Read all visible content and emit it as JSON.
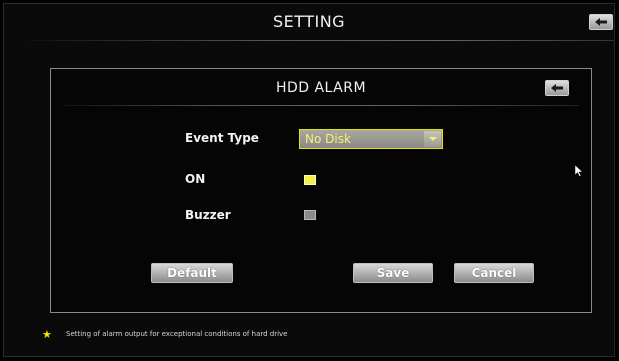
{
  "window": {
    "title": "SETTING",
    "back_icon": "left-arrow-icon"
  },
  "dialog": {
    "title": "HDD ALARM",
    "back_icon": "left-arrow-icon",
    "fields": {
      "event_type": {
        "label": "Event Type",
        "value": "No Disk"
      },
      "on": {
        "label": "ON",
        "checked": true
      },
      "buzzer": {
        "label": "Buzzer",
        "checked": false
      }
    },
    "buttons": {
      "default": "Default",
      "save": "Save",
      "cancel": "Cancel"
    }
  },
  "footer": {
    "star": "★",
    "hint": "Setting of alarm output for exceptional conditions of hard drive"
  },
  "colors": {
    "accent_yellow": "#f3ef4a",
    "select_text": "#f6f07a",
    "panel_border": "#8a8a8a"
  }
}
